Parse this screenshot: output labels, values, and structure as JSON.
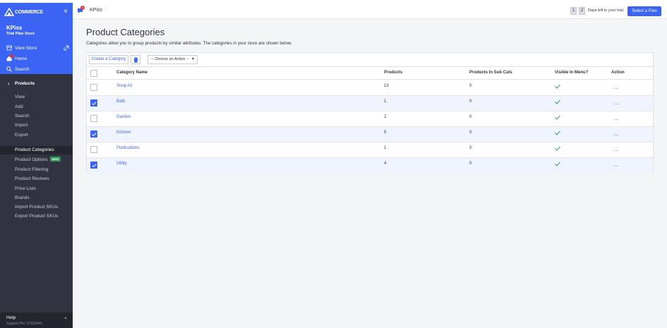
{
  "sidebar": {
    "logo_text": "COMMERCE",
    "store_name": "KPiss",
    "store_plan": "Trial Plan Store",
    "links": [
      {
        "label": "View Store",
        "icon": "storefront-icon"
      },
      {
        "label": "Home",
        "icon": "home-icon"
      },
      {
        "label": "Search",
        "icon": "search-icon"
      }
    ],
    "section_label": "Products",
    "items": [
      "View",
      "Add",
      "Search",
      "Import",
      "Export"
    ],
    "subitems": [
      {
        "label": "Product Categories",
        "active": true
      },
      {
        "label": "Product Options",
        "badge": "NEW"
      },
      {
        "label": "Product Filtering"
      },
      {
        "label": "Product Reviews"
      },
      {
        "label": "Price Lists"
      },
      {
        "label": "Brands"
      },
      {
        "label": "Import Product SKUs"
      },
      {
        "label": "Export Product SKUs"
      }
    ],
    "help_label": "Help",
    "support_pin": "Support Pin: 57322441"
  },
  "topbar": {
    "store_name": "KPiss",
    "notification_count": "3",
    "days_digits": [
      "1",
      "2"
    ],
    "days_text": "Days left in your trial.",
    "plan_button": "Select a Plan"
  },
  "main": {
    "title": "Product Categories",
    "description": "Categories allow you to group products by similar attributes. The categories in your store are shown below.",
    "create_button": "Create a Category",
    "action_select": "-- Choose an Action --",
    "columns": [
      "Category Name",
      "Products",
      "Products In Sub Cats",
      "Visible In Menu?",
      "Action"
    ],
    "rows": [
      {
        "name": "Shop All",
        "products": "13",
        "sub": "0",
        "checked": false,
        "visible": true
      },
      {
        "name": "Bath",
        "products": "1",
        "sub": "0",
        "checked": true,
        "visible": true
      },
      {
        "name": "Garden",
        "products": "2",
        "sub": "0",
        "checked": false,
        "visible": true
      },
      {
        "name": "Kitchen",
        "products": "5",
        "sub": "0",
        "checked": true,
        "visible": true
      },
      {
        "name": "Publications",
        "products": "1",
        "sub": "0",
        "checked": false,
        "visible": true
      },
      {
        "name": "Utility",
        "products": "4",
        "sub": "0",
        "checked": true,
        "visible": true
      }
    ],
    "action_glyph": "..."
  },
  "colors": {
    "brand_blue": "#3c64f4",
    "sidebar_dark": "#313440",
    "check_green": "#2e9c5c",
    "badge_red": "#db3643"
  }
}
